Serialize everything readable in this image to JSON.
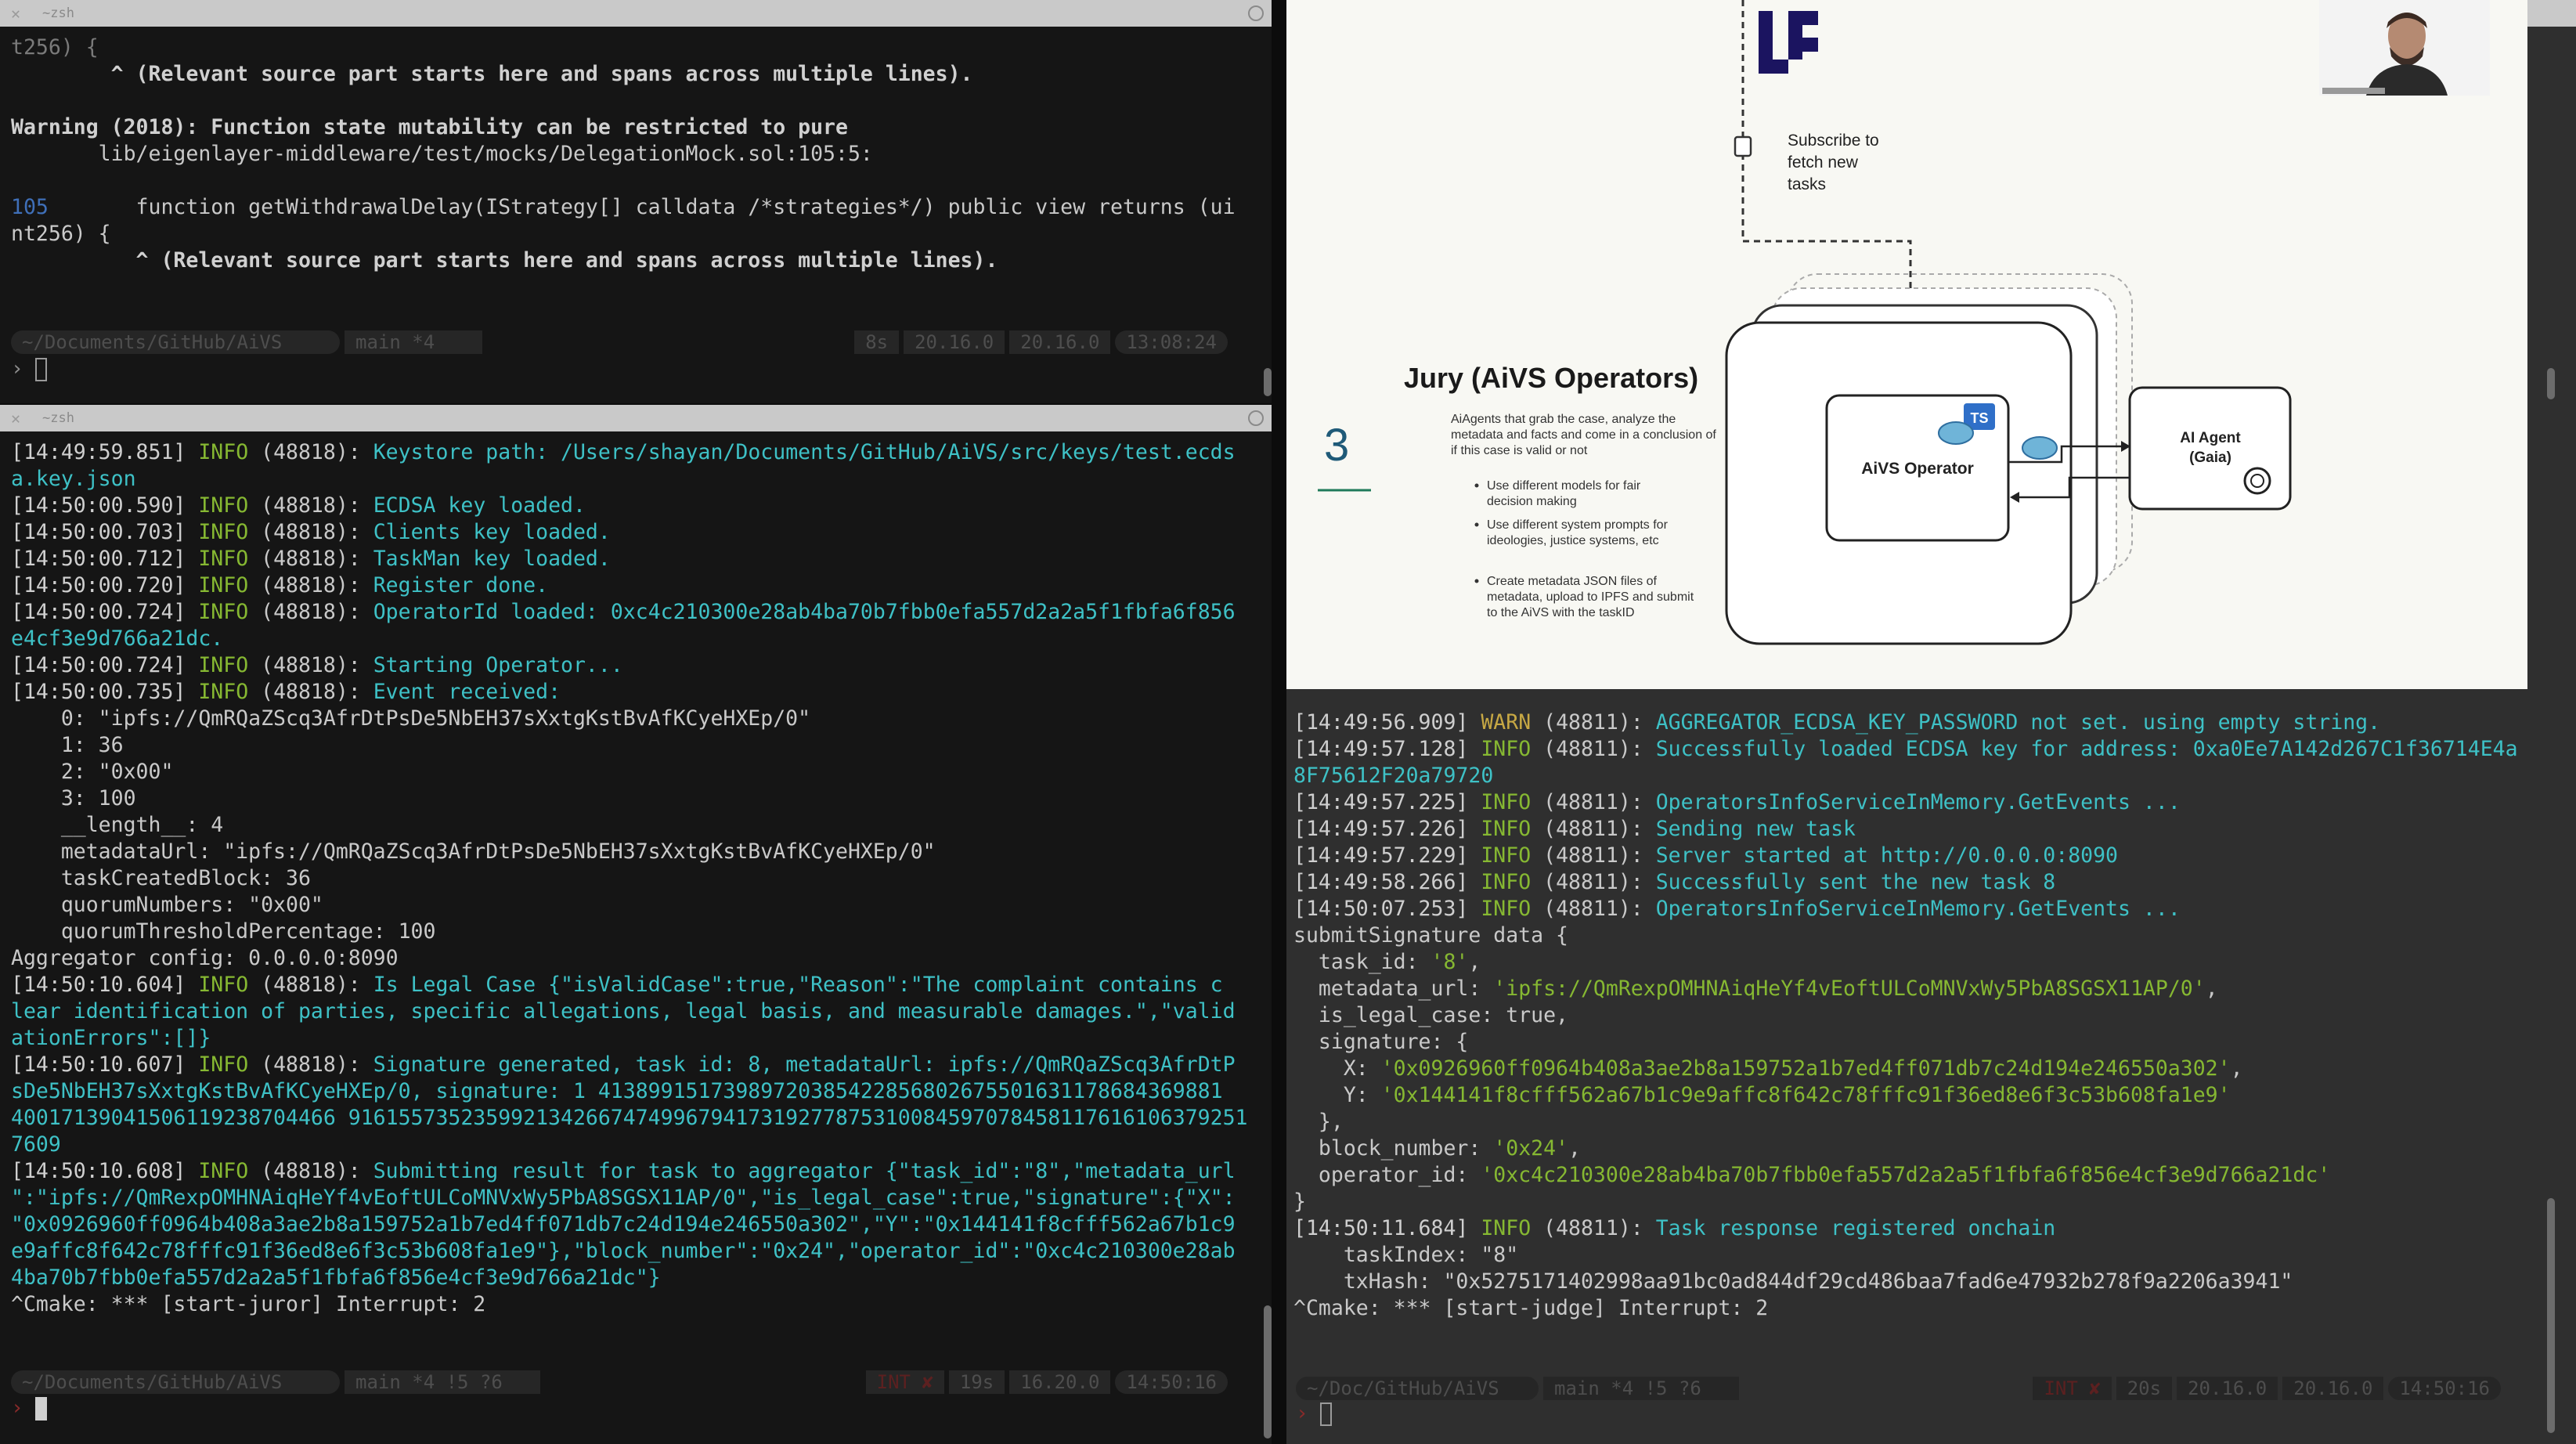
{
  "window": {
    "title": "~zsh"
  },
  "pane_top_left": {
    "title": "~zsh",
    "lines": [
      [
        {
          "t": "t256) {",
          "c": "dim"
        }
      ],
      [
        {
          "t": "      ",
          "c": ""
        },
        {
          "t": "  ^ (Relevant source part starts here and spans across multiple lines).",
          "c": "bold"
        }
      ],
      [
        {
          "t": "",
          "c": ""
        }
      ],
      [
        {
          "t": "Warning (2018): Function state mutability can be restricted to pure",
          "c": "bold"
        }
      ],
      [
        {
          "t": "       lib/eigenlayer-middleware/test/mocks/DelegationMock.sol:105:5:",
          "c": ""
        }
      ],
      [
        {
          "t": "",
          "c": ""
        }
      ],
      [
        {
          "t": "105",
          "c": "blue"
        },
        {
          "t": "       function getWithdrawalDelay(IStrategy[] calldata /*strategies*/) public view returns (ui",
          "c": ""
        }
      ],
      [
        {
          "t": "nt256) {",
          "c": ""
        }
      ],
      [
        {
          "t": "          ^ (Relevant source part starts here and spans across multiple lines).",
          "c": "bold"
        }
      ]
    ],
    "status": {
      "path": "~/Documents/GitHub/AiVS",
      "branch": "main *4",
      "duration": "8s",
      "node1": "20.16.0",
      "node2": "20.16.0",
      "time": "13:08:24"
    }
  },
  "pane_bottom_left": {
    "title": "~zsh",
    "lines": [
      [
        {
          "t": "[14:49:59.851] ",
          "c": "ts"
        },
        {
          "t": "INFO",
          "c": "info"
        },
        {
          "t": " (48818): ",
          "c": ""
        },
        {
          "t": "Keystore path: /Users/shayan/Documents/GitHub/AiVS/src/keys/test.ecds",
          "c": "cyan"
        }
      ],
      [
        {
          "t": "a.key.json",
          "c": "cyan"
        }
      ],
      [
        {
          "t": "[14:50:00.590] ",
          "c": "ts"
        },
        {
          "t": "INFO",
          "c": "info"
        },
        {
          "t": " (48818): ",
          "c": ""
        },
        {
          "t": "ECDSA key loaded.",
          "c": "cyan"
        }
      ],
      [
        {
          "t": "[14:50:00.703] ",
          "c": "ts"
        },
        {
          "t": "INFO",
          "c": "info"
        },
        {
          "t": " (48818): ",
          "c": ""
        },
        {
          "t": "Clients key loaded.",
          "c": "cyan"
        }
      ],
      [
        {
          "t": "[14:50:00.712] ",
          "c": "ts"
        },
        {
          "t": "INFO",
          "c": "info"
        },
        {
          "t": " (48818): ",
          "c": ""
        },
        {
          "t": "TaskMan key loaded.",
          "c": "cyan"
        }
      ],
      [
        {
          "t": "[14:50:00.720] ",
          "c": "ts"
        },
        {
          "t": "INFO",
          "c": "info"
        },
        {
          "t": " (48818): ",
          "c": ""
        },
        {
          "t": "Register done.",
          "c": "cyan"
        }
      ],
      [
        {
          "t": "[14:50:00.724] ",
          "c": "ts"
        },
        {
          "t": "INFO",
          "c": "info"
        },
        {
          "t": " (48818): ",
          "c": ""
        },
        {
          "t": "OperatorId loaded: 0xc4c210300e28ab4ba70b7fbb0efa557d2a2a5f1fbfa6f856",
          "c": "cyan"
        }
      ],
      [
        {
          "t": "e4cf3e9d766a21dc.",
          "c": "cyan"
        }
      ],
      [
        {
          "t": "[14:50:00.724] ",
          "c": "ts"
        },
        {
          "t": "INFO",
          "c": "info"
        },
        {
          "t": " (48818): ",
          "c": ""
        },
        {
          "t": "Starting Operator...",
          "c": "cyan"
        }
      ],
      [
        {
          "t": "[14:50:00.735] ",
          "c": "ts"
        },
        {
          "t": "INFO",
          "c": "info"
        },
        {
          "t": " (48818): ",
          "c": ""
        },
        {
          "t": "Event received:",
          "c": "cyan"
        }
      ],
      [
        {
          "t": "    0: \"ipfs://QmRQaZScq3AfrDtPsDe5NbEH37sXxtgKstBvAfKCyeHXEp/0\"",
          "c": ""
        }
      ],
      [
        {
          "t": "    1: 36",
          "c": ""
        }
      ],
      [
        {
          "t": "    2: \"0x00\"",
          "c": ""
        }
      ],
      [
        {
          "t": "    3: 100",
          "c": ""
        }
      ],
      [
        {
          "t": "    __length__: 4",
          "c": ""
        }
      ],
      [
        {
          "t": "    metadataUrl: \"ipfs://QmRQaZScq3AfrDtPsDe5NbEH37sXxtgKstBvAfKCyeHXEp/0\"",
          "c": ""
        }
      ],
      [
        {
          "t": "    taskCreatedBlock: 36",
          "c": ""
        }
      ],
      [
        {
          "t": "    quorumNumbers: \"0x00\"",
          "c": ""
        }
      ],
      [
        {
          "t": "    quorumThresholdPercentage: 100",
          "c": ""
        }
      ],
      [
        {
          "t": "Aggregator config: 0.0.0.0:8090",
          "c": ""
        }
      ],
      [
        {
          "t": "[14:50:10.604] ",
          "c": "ts"
        },
        {
          "t": "INFO",
          "c": "info"
        },
        {
          "t": " (48818): ",
          "c": ""
        },
        {
          "t": "Is Legal Case {\"isValidCase\":true,\"Reason\":\"The complaint contains c",
          "c": "cyan"
        }
      ],
      [
        {
          "t": "lear identification of parties, specific allegations, legal basis, and measurable damages.\",\"valid",
          "c": "cyan"
        }
      ],
      [
        {
          "t": "ationErrors\":[]}",
          "c": "cyan"
        }
      ],
      [
        {
          "t": "[14:50:10.607] ",
          "c": "ts"
        },
        {
          "t": "INFO",
          "c": "info"
        },
        {
          "t": " (48818): ",
          "c": ""
        },
        {
          "t": "Signature generated, task id: 8, metadataUrl: ipfs://QmRQaZScq3AfrDtP",
          "c": "cyan"
        }
      ],
      [
        {
          "t": "sDe5NbEH37sXxtgKstBvAfKCyeHXEp/0, signature: 1 41389915173989720385422856802675501631178684369881",
          "c": "cyan"
        }
      ],
      [
        {
          "t": "40017139041506119238704466 916155735235992134266747499679417319277875310084597078458117616106379251",
          "c": "cyan"
        }
      ],
      [
        {
          "t": "7609",
          "c": "cyan"
        }
      ],
      [
        {
          "t": "[14:50:10.608] ",
          "c": "ts"
        },
        {
          "t": "INFO",
          "c": "info"
        },
        {
          "t": " (48818): ",
          "c": ""
        },
        {
          "t": "Submitting result for task to aggregator {\"task_id\":\"8\",\"metadata_url",
          "c": "cyan"
        }
      ],
      [
        {
          "t": "\":\"ipfs://QmRexpOMHNAiqHeYf4vEoftULCoMNVxWy5PbA8SGSX11AP/0\",\"is_legal_case\":true,\"signature\":{\"X\":",
          "c": "cyan"
        }
      ],
      [
        {
          "t": "\"0x0926960ff0964b408a3ae2b8a159752a1b7ed4ff071db7c24d194e246550a302\",\"Y\":\"0x144141f8cfff562a67b1c9",
          "c": "cyan"
        }
      ],
      [
        {
          "t": "e9affc8f642c78fffc91f36ed8e6f3c53b608fa1e9\"},\"block_number\":\"0x24\",\"operator_id\":\"0xc4c210300e28ab",
          "c": "cyan"
        }
      ],
      [
        {
          "t": "4ba70b7fbb0efa557d2a2a5f1fbfa6f856e4cf3e9d766a21dc\"}",
          "c": "cyan"
        }
      ],
      [
        {
          "t": "^Cmake: *** [start-juror] Interrupt: 2",
          "c": ""
        }
      ]
    ],
    "status": {
      "path": "~/Documents/GitHub/AiVS",
      "branch": "main *4 !5 ?6",
      "exit": "INT ✘",
      "duration": "19s",
      "node1": "16.20.0",
      "time": "14:50:16"
    }
  },
  "slide": {
    "step_label": "Subscribe to fetch new tasks",
    "number": "3",
    "heading": "Jury (AiVS Operators)",
    "description": "AiAgents that grab the case, analyze the metadata and facts and come in a conclusion of if this case is valid or not",
    "bullets": [
      "Use different models for fair decision making",
      "Use different system prompts for ideologies, justice systems, etc",
      "Create metadata JSON files of metadata, upload to IPFS and submit to the AiVS with the taskID"
    ],
    "box1": "AiVS Operator",
    "box2_line1": "AI Agent",
    "box2_line2": "(Gaia)",
    "ts_badge": "TS"
  },
  "pane_bottom_right": {
    "lines": [
      [
        {
          "t": "[14:49:56.909] ",
          "c": "ts"
        },
        {
          "t": "WARN",
          "c": "warn"
        },
        {
          "t": " (48811): ",
          "c": ""
        },
        {
          "t": "AGGREGATOR_ECDSA_KEY_PASSWORD not set. using empty string.",
          "c": "cyan"
        }
      ],
      [
        {
          "t": "[14:49:57.128] ",
          "c": "ts"
        },
        {
          "t": "INFO",
          "c": "info"
        },
        {
          "t": " (48811): ",
          "c": ""
        },
        {
          "t": "Successfully loaded ECDSA key for address: 0xa0Ee7A142d267C1f36714E4a",
          "c": "cyan"
        }
      ],
      [
        {
          "t": "8F75612F20a79720",
          "c": "cyan"
        }
      ],
      [
        {
          "t": "[14:49:57.225] ",
          "c": "ts"
        },
        {
          "t": "INFO",
          "c": "info"
        },
        {
          "t": " (48811): ",
          "c": ""
        },
        {
          "t": "OperatorsInfoServiceInMemory.GetEvents ...",
          "c": "cyan"
        }
      ],
      [
        {
          "t": "[14:49:57.226] ",
          "c": "ts"
        },
        {
          "t": "INFO",
          "c": "info"
        },
        {
          "t": " (48811): ",
          "c": ""
        },
        {
          "t": "Sending new task",
          "c": "cyan"
        }
      ],
      [
        {
          "t": "[14:49:57.229] ",
          "c": "ts"
        },
        {
          "t": "INFO",
          "c": "info"
        },
        {
          "t": " (48811): ",
          "c": ""
        },
        {
          "t": "Server started at http://0.0.0.0:8090",
          "c": "cyan"
        }
      ],
      [
        {
          "t": "[14:49:58.266] ",
          "c": "ts"
        },
        {
          "t": "INFO",
          "c": "info"
        },
        {
          "t": " (48811): ",
          "c": ""
        },
        {
          "t": "Successfully sent the new task 8",
          "c": "cyan"
        }
      ],
      [
        {
          "t": "[14:50:07.253] ",
          "c": "ts"
        },
        {
          "t": "INFO",
          "c": "info"
        },
        {
          "t": " (48811): ",
          "c": ""
        },
        {
          "t": "OperatorsInfoServiceInMemory.GetEvents ...",
          "c": "cyan"
        }
      ],
      [
        {
          "t": "submitSignature data {",
          "c": ""
        }
      ],
      [
        {
          "t": "  task_id: ",
          "c": ""
        },
        {
          "t": "'8'",
          "c": "green"
        },
        {
          "t": ",",
          "c": ""
        }
      ],
      [
        {
          "t": "  metadata_url: ",
          "c": ""
        },
        {
          "t": "'ipfs://QmRexpOMHNAiqHeYf4vEoftULCoMNVxWy5PbA8SGSX11AP/0'",
          "c": "green"
        },
        {
          "t": ",",
          "c": ""
        }
      ],
      [
        {
          "t": "  is_legal_case: true,",
          "c": ""
        }
      ],
      [
        {
          "t": "  signature: {",
          "c": ""
        }
      ],
      [
        {
          "t": "    X: ",
          "c": ""
        },
        {
          "t": "'0x0926960ff0964b408a3ae2b8a159752a1b7ed4ff071db7c24d194e246550a302'",
          "c": "green"
        },
        {
          "t": ",",
          "c": ""
        }
      ],
      [
        {
          "t": "    Y: ",
          "c": ""
        },
        {
          "t": "'0x144141f8cfff562a67b1c9e9affc8f642c78fffc91f36ed8e6f3c53b608fa1e9'",
          "c": "green"
        }
      ],
      [
        {
          "t": "  },",
          "c": ""
        }
      ],
      [
        {
          "t": "  block_number: ",
          "c": ""
        },
        {
          "t": "'0x24'",
          "c": "green"
        },
        {
          "t": ",",
          "c": ""
        }
      ],
      [
        {
          "t": "  operator_id: ",
          "c": ""
        },
        {
          "t": "'0xc4c210300e28ab4ba70b7fbb0efa557d2a2a5f1fbfa6f856e4cf3e9d766a21dc'",
          "c": "green"
        }
      ],
      [
        {
          "t": "}",
          "c": ""
        }
      ],
      [
        {
          "t": "[14:50:11.684] ",
          "c": "ts"
        },
        {
          "t": "INFO",
          "c": "info"
        },
        {
          "t": " (48811): ",
          "c": ""
        },
        {
          "t": "Task response registered onchain",
          "c": "cyan"
        }
      ],
      [
        {
          "t": "    taskIndex: \"8\"",
          "c": ""
        }
      ],
      [
        {
          "t": "    txHash: \"0x5275171402998aa91bc0ad844df29cd486baa7fad6e47932b278f9a2206a3941\"",
          "c": ""
        }
      ],
      [
        {
          "t": "^Cmake: *** [start-judge] Interrupt: 2",
          "c": ""
        }
      ]
    ],
    "status": {
      "path": "~/Doc/GitHub/AiVS",
      "branch": "main *4 !5 ?6",
      "exit": "INT ✘",
      "duration": "20s",
      "node1": "20.16.0",
      "node2": "20.16.0",
      "time": "14:50:16"
    }
  }
}
